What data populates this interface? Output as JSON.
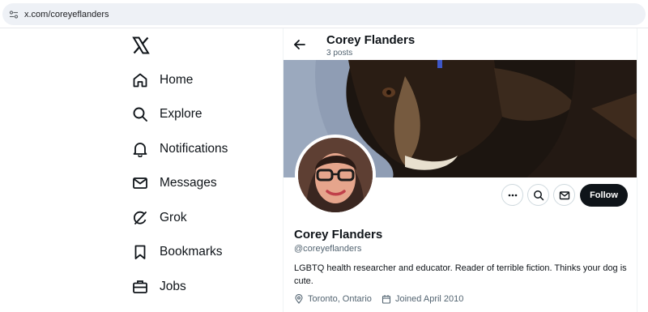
{
  "browser": {
    "url": "x.com/coreyeflanders"
  },
  "nav": {
    "logo": "x-logo-icon",
    "items": [
      {
        "label": "Home",
        "icon": "home-icon"
      },
      {
        "label": "Explore",
        "icon": "search-icon"
      },
      {
        "label": "Notifications",
        "icon": "bell-icon"
      },
      {
        "label": "Messages",
        "icon": "envelope-icon"
      },
      {
        "label": "Grok",
        "icon": "grok-icon"
      },
      {
        "label": "Bookmarks",
        "icon": "bookmark-icon"
      },
      {
        "label": "Jobs",
        "icon": "briefcase-icon"
      }
    ]
  },
  "header": {
    "name": "Corey Flanders",
    "posts": "3 posts"
  },
  "profile": {
    "name": "Corey Flanders",
    "handle": "@coreyeflanders",
    "bio": "LGBTQ health researcher and educator. Reader of terrible fiction. Thinks your dog is cute.",
    "location": "Toronto, Ontario",
    "joined": "Joined April 2010",
    "follow_label": "Follow"
  },
  "colors": {
    "follow_bg": "#0f1419",
    "secondary_text": "#536471",
    "border": "#cfd9de"
  }
}
